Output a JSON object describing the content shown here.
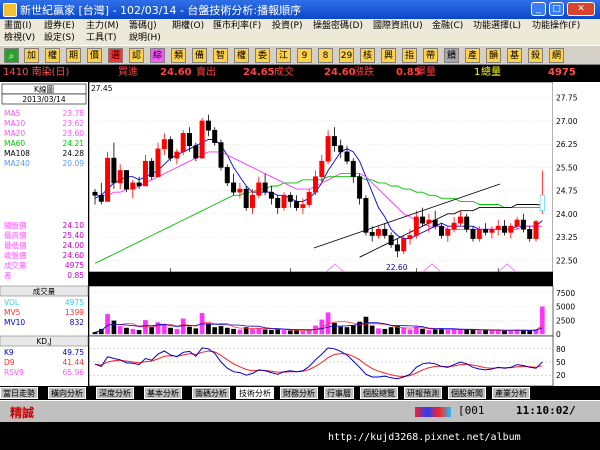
{
  "window": {
    "title": "新世紀贏家 [台灣] - 102/03/14 - 台盤技術分析:播報順序"
  },
  "menu": {
    "row1": [
      "畫面(I)",
      "證券(E)",
      "主力(M)",
      "籌碼(J)",
      "期權(O)",
      "匯市利率(F)",
      "投資(P)",
      "操盤密碼(D)",
      "國際資訊(U)",
      "金融(C)",
      "功能選擇(L)",
      "功能操作(F)"
    ],
    "row2": [
      "檢視(V)",
      "設定(S)",
      "工具(T)",
      "說明(H)"
    ]
  },
  "toolbar": {
    "buttons": [
      "加",
      "權",
      "期",
      "價",
      "選",
      "認",
      "綜",
      "類",
      "備",
      "智",
      "權",
      "委",
      "江",
      "9",
      "8",
      "29",
      "核",
      "興",
      "指",
      "帶",
      "饋",
      "產",
      "韻",
      "基",
      "殺",
      "網"
    ],
    "colors": [
      "#ffd24a",
      "#ffd24a",
      "#ffd24a",
      "#ffd24a",
      "#ff3030",
      "#ffd24a",
      "#ff55ff",
      "#ffd24a",
      "#ffd24a",
      "#ffd24a",
      "#ffd24a",
      "#ffd24a",
      "#ffd24a",
      "#ffd24a",
      "#ffd24a",
      "#ffd24a",
      "#ffd24a",
      "#ffd24a",
      "#ffd24a",
      "#ffd24a",
      "#a9a9a9",
      "#ffd24a",
      "#ffd24a",
      "#ffd24a",
      "#ffd24a",
      "#ffd24a"
    ]
  },
  "quote": {
    "symbol": "1410 南染(日)",
    "buy_label": "買進",
    "buy": "24.60",
    "sell_label": "賣出",
    "sell": "24.65",
    "deal_label": "成交",
    "deal": "24.60",
    "change_label": "漲跌",
    "change": "0.85",
    "single_label": "單量",
    "single": "1",
    "total_label": "總量",
    "total": "4975"
  },
  "side_panel": {
    "title": "K線圖",
    "date": "2013/03/14",
    "ma": [
      {
        "label": "MA5",
        "value": "23.78",
        "color": "#ff55ff"
      },
      {
        "label": "MA10",
        "value": "23.62",
        "color": "#ff55ff"
      },
      {
        "label": "MA20",
        "value": "23.60",
        "color": "#ff55ff"
      },
      {
        "label": "MA60",
        "value": "24.21",
        "color": "#00d000"
      },
      {
        "label": "MA108",
        "value": "24.28",
        "color": "#000000"
      },
      {
        "label": "MA240",
        "value": "20.09",
        "color": "#5599ff"
      }
    ],
    "prices": [
      {
        "label": "開盤價",
        "value": "24.10"
      },
      {
        "label": "最高價",
        "value": "25.40"
      },
      {
        "label": "最低價",
        "value": "24.00"
      },
      {
        "label": "收盤價",
        "value": "24.60"
      },
      {
        "label": "成交量",
        "value": "4975"
      },
      {
        "label": "差",
        "value": "0.85"
      }
    ],
    "vol_title": "成交量",
    "vol": [
      {
        "label": "VOL",
        "value": "4975",
        "color": "#33ccff"
      },
      {
        "label": "MV5",
        "value": "1399",
        "color": "#ff3030"
      },
      {
        "label": "MV10",
        "value": "832",
        "color": "#0000cc"
      }
    ],
    "kd_title": "KD,J",
    "kd": [
      {
        "label": "K9",
        "value": "49.75",
        "color": "#0000cc"
      },
      {
        "label": "D9",
        "value": "41.44",
        "color": "#ff3030"
      },
      {
        "label": "RSV9",
        "value": "65.96",
        "color": "#ff55ff"
      }
    ]
  },
  "price_chart": {
    "y_ticks": [
      "27.75",
      "27.00",
      "26.25",
      "25.50",
      "24.75",
      "24.00",
      "23.25",
      "22.50"
    ],
    "y_top_label": "27.45",
    "low_label": "22.60",
    "x_labels": [
      "12",
      "13/01",
      "02",
      "03"
    ]
  },
  "vol_chart": {
    "y_ticks": [
      "7500",
      "5000",
      "2500",
      "0"
    ]
  },
  "kd_chart": {
    "y_ticks": [
      "80",
      "50",
      "20"
    ]
  },
  "chart_data": {
    "type": "candlestick",
    "title": "1410 南染(日) K線圖",
    "series": [
      {
        "name": "K線",
        "ohlc": [
          [
            24.7,
            24.8,
            24.3,
            24.6
          ],
          [
            24.6,
            25.0,
            24.3,
            24.4
          ],
          [
            24.4,
            26.0,
            24.4,
            25.8
          ],
          [
            25.8,
            26.3,
            24.8,
            25.0
          ],
          [
            25.0,
            25.6,
            24.8,
            25.4
          ],
          [
            25.4,
            25.4,
            24.7,
            24.8
          ],
          [
            24.8,
            25.1,
            24.5,
            25.0
          ],
          [
            25.0,
            25.2,
            24.8,
            24.9
          ],
          [
            24.9,
            25.9,
            24.9,
            25.7
          ],
          [
            25.7,
            25.8,
            25.1,
            25.2
          ],
          [
            25.2,
            26.3,
            25.2,
            26.1
          ],
          [
            26.1,
            26.6,
            25.9,
            26.4
          ],
          [
            26.4,
            26.5,
            25.7,
            25.8
          ],
          [
            25.8,
            26.1,
            25.6,
            26.0
          ],
          [
            26.0,
            26.7,
            25.9,
            26.6
          ],
          [
            26.6,
            26.8,
            26.0,
            26.2
          ],
          [
            26.2,
            26.3,
            25.7,
            25.8
          ],
          [
            25.8,
            27.1,
            25.8,
            27.0
          ],
          [
            27.0,
            27.2,
            26.5,
            26.7
          ],
          [
            26.7,
            26.8,
            26.2,
            26.3
          ],
          [
            26.3,
            26.4,
            25.4,
            25.5
          ],
          [
            25.5,
            25.6,
            24.9,
            25.0
          ],
          [
            25.0,
            25.3,
            24.6,
            24.7
          ],
          [
            24.7,
            25.0,
            24.5,
            24.8
          ],
          [
            24.8,
            24.9,
            24.1,
            24.2
          ],
          [
            24.2,
            24.8,
            24.0,
            24.6
          ],
          [
            24.6,
            25.2,
            24.5,
            25.0
          ],
          [
            25.0,
            25.3,
            24.6,
            24.7
          ],
          [
            24.7,
            24.9,
            24.3,
            24.5
          ],
          [
            24.5,
            24.6,
            24.0,
            24.2
          ],
          [
            24.2,
            24.7,
            24.1,
            24.6
          ],
          [
            24.6,
            24.7,
            24.2,
            24.4
          ],
          [
            24.4,
            24.6,
            24.1,
            24.2
          ],
          [
            24.2,
            24.5,
            24.0,
            24.3
          ],
          [
            24.3,
            24.8,
            24.2,
            24.7
          ],
          [
            24.7,
            25.4,
            24.6,
            25.2
          ],
          [
            25.2,
            25.9,
            25.0,
            25.7
          ],
          [
            25.7,
            26.7,
            25.6,
            26.5
          ],
          [
            26.5,
            26.8,
            26.0,
            26.2
          ],
          [
            26.2,
            26.4,
            25.8,
            26.0
          ],
          [
            26.0,
            26.2,
            25.6,
            25.7
          ],
          [
            25.7,
            25.8,
            25.0,
            25.2
          ],
          [
            25.2,
            25.3,
            24.3,
            24.5
          ],
          [
            24.5,
            24.6,
            23.3,
            23.4
          ],
          [
            23.4,
            23.6,
            23.1,
            23.3
          ],
          [
            23.3,
            23.6,
            23.2,
            23.5
          ],
          [
            23.5,
            23.7,
            23.2,
            23.3
          ],
          [
            23.3,
            23.4,
            22.9,
            23.0
          ],
          [
            23.0,
            23.2,
            22.6,
            22.8
          ],
          [
            22.8,
            23.3,
            22.7,
            23.2
          ],
          [
            23.2,
            23.5,
            23.0,
            23.3
          ],
          [
            23.3,
            24.1,
            23.2,
            23.9
          ],
          [
            23.9,
            24.2,
            23.6,
            23.7
          ],
          [
            23.7,
            24.0,
            23.4,
            23.8
          ],
          [
            23.8,
            24.1,
            23.5,
            23.6
          ],
          [
            23.6,
            23.7,
            23.2,
            23.3
          ],
          [
            23.3,
            23.6,
            23.1,
            23.5
          ],
          [
            23.5,
            23.9,
            23.4,
            23.7
          ],
          [
            23.7,
            24.1,
            23.6,
            23.9
          ],
          [
            23.9,
            24.0,
            23.4,
            23.5
          ],
          [
            23.5,
            23.6,
            23.1,
            23.2
          ],
          [
            23.2,
            23.6,
            23.1,
            23.5
          ],
          [
            23.5,
            23.7,
            23.3,
            23.4
          ],
          [
            23.4,
            23.6,
            23.2,
            23.5
          ],
          [
            23.5,
            23.8,
            23.3,
            23.6
          ],
          [
            23.6,
            23.8,
            23.3,
            23.4
          ],
          [
            23.4,
            23.7,
            23.2,
            23.6
          ],
          [
            23.6,
            23.9,
            23.5,
            23.8
          ],
          [
            23.8,
            24.0,
            23.4,
            23.5
          ],
          [
            23.5,
            23.6,
            23.1,
            23.2
          ],
          [
            23.2,
            23.8,
            23.1,
            23.75
          ],
          [
            24.1,
            25.4,
            24.0,
            24.6
          ]
        ]
      },
      {
        "name": "成交量",
        "values": [
          300,
          900,
          3600,
          2400,
          1400,
          1100,
          900,
          700,
          2500,
          1200,
          2100,
          1800,
          1100,
          900,
          2800,
          1300,
          1000,
          3800,
          1900,
          1200,
          1400,
          1100,
          900,
          800,
          1200,
          900,
          1100,
          800,
          700,
          900,
          700,
          600,
          600,
          500,
          800,
          1500,
          2600,
          3900,
          2000,
          1300,
          1200,
          1500,
          2200,
          3100,
          1500,
          1000,
          900,
          1200,
          1400,
          1100,
          800,
          1300,
          900,
          700,
          800,
          900,
          700,
          800,
          900,
          800,
          700,
          600,
          700,
          600,
          700,
          600,
          700,
          800,
          700,
          600,
          800,
          4975
        ]
      },
      {
        "name": "K9",
        "values": [
          45,
          40,
          62,
          58,
          55,
          48,
          47,
          44,
          58,
          54,
          68,
          75,
          66,
          62,
          72,
          74,
          63,
          82,
          80,
          70,
          50,
          36,
          28,
          26,
          20,
          24,
          32,
          30,
          26,
          22,
          28,
          30,
          28,
          30,
          40,
          55,
          68,
          82,
          80,
          74,
          66,
          52,
          38,
          22,
          16,
          16,
          18,
          14,
          12,
          16,
          22,
          38,
          46,
          48,
          46,
          40,
          38,
          44,
          50,
          46,
          38,
          34,
          32,
          34,
          38,
          36,
          38,
          44,
          42,
          38,
          36,
          49.75
        ]
      },
      {
        "name": "D9",
        "values": [
          45,
          43,
          50,
          53,
          54,
          52,
          50,
          48,
          51,
          52,
          57,
          63,
          64,
          63,
          66,
          69,
          67,
          72,
          75,
          73,
          65,
          55,
          46,
          39,
          33,
          30,
          31,
          31,
          29,
          27,
          27,
          28,
          28,
          29,
          33,
          40,
          49,
          60,
          67,
          69,
          68,
          63,
          55,
          44,
          35,
          29,
          25,
          21,
          18,
          17,
          19,
          25,
          32,
          37,
          40,
          40,
          39,
          41,
          44,
          45,
          43,
          40,
          37,
          36,
          37,
          37,
          37,
          39,
          40,
          39,
          38,
          41.44
        ]
      }
    ],
    "ma_lines": {
      "MA5": [
        24.5,
        24.6,
        24.8,
        25.0,
        25.1,
        25.2,
        25.2,
        25.1,
        25.2,
        25.3,
        25.4,
        25.6,
        25.8,
        25.9,
        26.0,
        26.1,
        26.2,
        26.3,
        26.4,
        26.4,
        26.2,
        25.9,
        25.5,
        25.2,
        24.9,
        24.7,
        24.7,
        24.7,
        24.7,
        24.6,
        24.6,
        24.5,
        24.4,
        24.4,
        24.5,
        24.7,
        25.0,
        25.4,
        25.7,
        26.0,
        26.1,
        26.0,
        25.7,
        25.2,
        24.7,
        24.2,
        23.9,
        23.5,
        23.3,
        23.2,
        23.2,
        23.3,
        23.4,
        23.5,
        23.6,
        23.7,
        23.6,
        23.6,
        23.6,
        23.6,
        23.6,
        23.5,
        23.5,
        23.5,
        23.5,
        23.5,
        23.5,
        23.6,
        23.6,
        23.6,
        23.6,
        23.78
      ],
      "MA20": [
        24.6,
        24.6,
        24.6,
        24.7,
        24.7,
        24.8,
        24.8,
        24.9,
        25.0,
        25.1,
        25.2,
        25.3,
        25.4,
        25.5,
        25.6,
        25.7,
        25.8,
        25.9,
        26.0,
        26.0,
        26.0,
        25.9,
        25.8,
        25.7,
        25.6,
        25.5,
        25.4,
        25.3,
        25.2,
        25.1,
        25.0,
        24.9,
        24.8,
        24.8,
        24.8,
        24.9,
        25.0,
        25.1,
        25.2,
        25.3,
        25.3,
        25.3,
        25.3,
        25.2,
        25.0,
        24.8,
        24.6,
        24.4,
        24.2,
        24.0,
        23.9,
        23.8,
        23.7,
        23.6,
        23.6,
        23.6,
        23.5,
        23.5,
        23.5,
        23.5,
        23.5,
        23.5,
        23.5,
        23.5,
        23.5,
        23.5,
        23.5,
        23.5,
        23.6,
        23.6,
        23.6,
        23.6
      ],
      "MA60": [
        22.4,
        22.5,
        22.6,
        22.7,
        22.8,
        22.9,
        23.0,
        23.1,
        23.2,
        23.3,
        23.4,
        23.5,
        23.6,
        23.7,
        23.8,
        23.9,
        24.0,
        24.1,
        24.2,
        24.3,
        24.4,
        24.5,
        24.6,
        24.6,
        24.7,
        24.7,
        24.8,
        24.8,
        24.9,
        24.9,
        25.0,
        25.0,
        25.0,
        25.1,
        25.1,
        25.1,
        25.1,
        25.2,
        25.2,
        25.2,
        25.2,
        25.2,
        25.2,
        25.1,
        25.1,
        25.0,
        25.0,
        24.9,
        24.9,
        24.8,
        24.8,
        24.7,
        24.7,
        24.6,
        24.6,
        24.5,
        24.5,
        24.5,
        24.4,
        24.4,
        24.4,
        24.3,
        24.3,
        24.3,
        24.3,
        24.2,
        24.2,
        24.2,
        24.2,
        24.2,
        24.2,
        24.21
      ],
      "MA108": [
        null,
        null,
        null,
        null,
        null,
        null,
        null,
        null,
        null,
        null,
        null,
        null,
        null,
        null,
        null,
        null,
        null,
        null,
        null,
        null,
        null,
        null,
        null,
        null,
        null,
        null,
        null,
        null,
        null,
        null,
        null,
        null,
        null,
        null,
        null,
        null,
        null,
        null,
        null,
        null,
        null,
        null,
        22.6,
        22.7,
        22.8,
        22.9,
        23.0,
        23.1,
        23.2,
        23.3,
        23.4,
        23.5,
        23.6,
        23.7,
        23.8,
        23.9,
        24.0,
        24.0,
        24.1,
        24.1,
        24.1,
        24.2,
        24.2,
        24.2,
        24.2,
        24.2,
        24.2,
        24.3,
        24.3,
        24.3,
        24.3,
        24.28
      ]
    },
    "ylim": [
      22.25,
      28.0
    ],
    "xlabel": "",
    "ylabel": ""
  }
}
